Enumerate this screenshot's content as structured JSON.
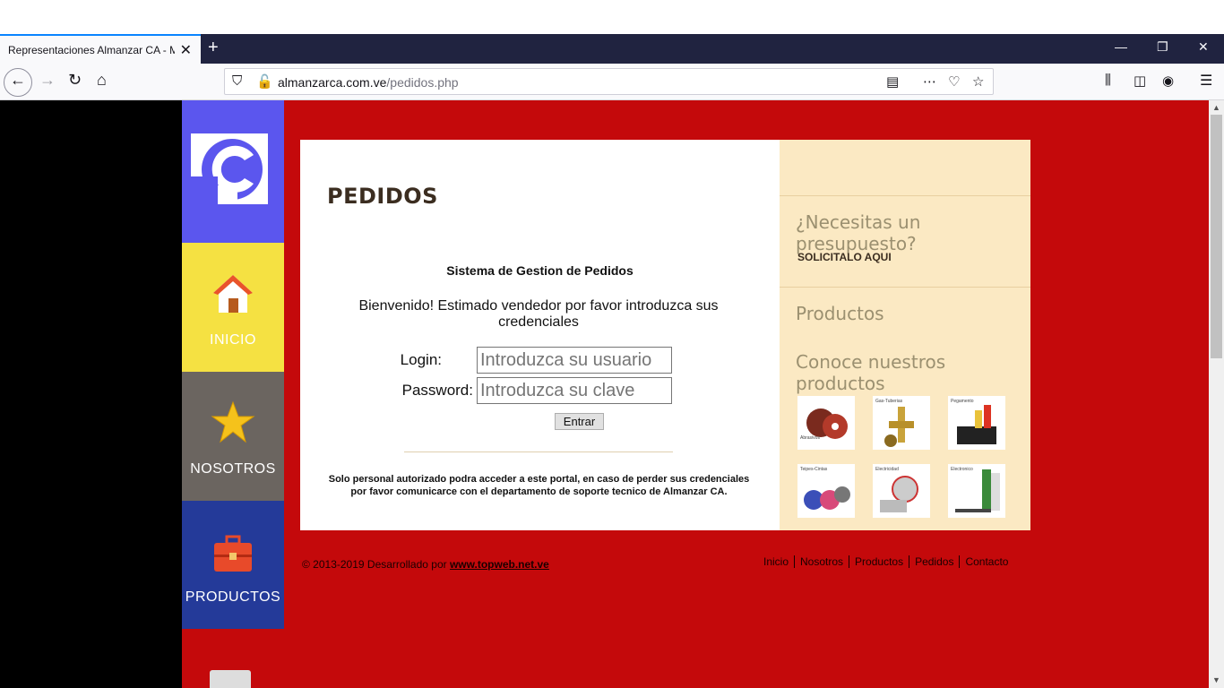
{
  "browser": {
    "tab_title": "Representaciones Almanzar CA - M",
    "url_domain": "almanzarca.com.ve",
    "url_path": "/pedidos.php"
  },
  "sidebar": {
    "items": [
      {
        "label": "INICIO"
      },
      {
        "label": "NOSOTROS"
      },
      {
        "label": "PRODUCTOS"
      }
    ]
  },
  "main": {
    "heading": "PEDIDOS",
    "system_title": "Sistema de Gestion de Pedidos",
    "welcome": "Bienvenido! Estimado vendedor por favor introduzca sus credenciales",
    "login_label": "Login:",
    "login_placeholder": "Introduzca su usuario",
    "password_label": "Password:",
    "password_placeholder": "Introduzca su clave",
    "submit_label": "Entrar",
    "notice": "Solo personal autorizado podra acceder a este portal, en caso de perder sus credenciales por favor comunicarce con el departamento de soporte tecnico de Almanzar CA."
  },
  "right_panel": {
    "budget_heading": "¿Necesitas un presupuesto?",
    "budget_link": "SOLICITALO AQUI",
    "products_heading": "Productos",
    "products_sub": "Conoce nuestros productos",
    "thumbs": [
      {
        "label": "Abrasivos"
      },
      {
        "label": "Gas-Tuberias"
      },
      {
        "label": "Pegamento"
      },
      {
        "label": "Teipes-Cintas"
      },
      {
        "label": "Electricidad"
      },
      {
        "label": "Electronico"
      }
    ]
  },
  "footer": {
    "copyright": "© 2013-2019 Desarrollado por ",
    "link": "www.topweb.net.ve",
    "nav": [
      "Inicio",
      "Nosotros",
      "Productos",
      "Pedidos",
      "Contacto"
    ]
  },
  "colors": {
    "page_bg": "#c4090b",
    "logo_bg": "#5b56ee",
    "home_bg": "#f5e142",
    "about_bg": "#6b6560",
    "products_bg": "#243a99",
    "panel_bg": "#fbe9c3"
  }
}
